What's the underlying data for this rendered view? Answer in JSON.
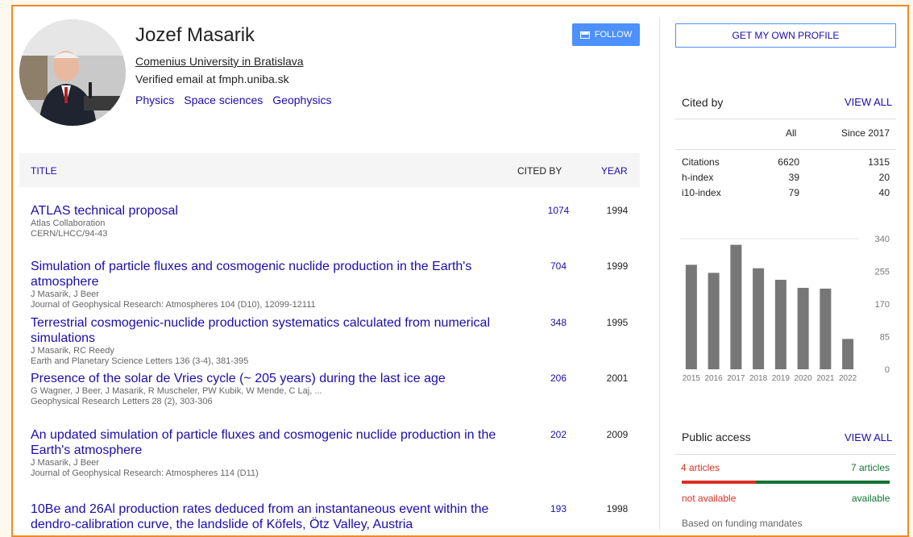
{
  "profile": {
    "name": "Jozef Masarik",
    "affiliation": "Comenius University in Bratislava",
    "email": "Verified email at fmph.uniba.sk",
    "interests": [
      "Physics",
      "Space sciences",
      "Geophysics"
    ],
    "follow_label": "FOLLOW",
    "get_profile_label": "GET MY OWN PROFILE"
  },
  "table": {
    "headers": {
      "title": "TITLE",
      "cited_by": "CITED BY",
      "year": "YEAR"
    },
    "rows": [
      {
        "title": "ATLAS technical proposal",
        "authors": "Atlas Collaboration",
        "venue": "CERN/LHCC/94-43",
        "cited_by": "1074",
        "year": "1994"
      },
      {
        "title": "Simulation of particle fluxes and cosmogenic nuclide production in the Earth's atmosphere",
        "authors": "J Masarik, J Beer",
        "venue": "Journal of Geophysical Research: Atmospheres 104 (D10), 12099-12111",
        "cited_by": "704",
        "year": "1999"
      },
      {
        "title": "Terrestrial cosmogenic-nuclide production systematics calculated from numerical simulations",
        "authors": "J Masarik, RC Reedy",
        "venue": "Earth and Planetary Science Letters 136 (3-4), 381-395",
        "cited_by": "348",
        "year": "1995"
      },
      {
        "title": "Presence of the solar de Vries cycle (~ 205 years) during the last ice age",
        "authors": "G Wagner, J Beer, J Masarik, R Muscheler, PW Kubik, W Mende, C Laj, ...",
        "venue": "Geophysical Research Letters 28 (2), 303-306",
        "cited_by": "206",
        "year": "2001"
      },
      {
        "title": "An updated simulation of particle fluxes and cosmogenic nuclide production in the Earth's atmosphere",
        "authors": "J Masarik, J Beer",
        "venue": "Journal of Geophysical Research: Atmospheres 114 (D11)",
        "cited_by": "202",
        "year": "2009"
      },
      {
        "title": "10Be and 26Al production rates deduced from an instantaneous event within the dendro-calibration curve, the landslide of Köfels, Ötz Valley, Austria",
        "authors": "",
        "venue": "",
        "cited_by": "193",
        "year": "1998"
      }
    ]
  },
  "cited_by": {
    "title": "Cited by",
    "view_all": "VIEW ALL",
    "col_all": "All",
    "col_since": "Since 2017",
    "rows": [
      {
        "label": "Citations",
        "all": "6620",
        "since": "1315"
      },
      {
        "label": "h-index",
        "all": "39",
        "since": "20"
      },
      {
        "label": "i10-index",
        "all": "79",
        "since": "40"
      }
    ]
  },
  "chart_data": {
    "type": "bar",
    "categories": [
      "2015",
      "2016",
      "2017",
      "2018",
      "2019",
      "2020",
      "2021",
      "2022"
    ],
    "values": [
      272,
      251,
      324,
      263,
      233,
      212,
      210,
      79
    ],
    "ylim": [
      0,
      340
    ],
    "yticks": [
      "340",
      "255",
      "170",
      "85",
      "0"
    ],
    "bar_color": "#777777"
  },
  "public_access": {
    "title": "Public access",
    "view_all": "VIEW ALL",
    "not_available_count": "4 articles",
    "available_count": "7 articles",
    "not_available_label": "not available",
    "available_label": "available",
    "note": "Based on funding mandates",
    "available_fraction": 0.64
  },
  "colors": {
    "accent_orange": "#f08a24",
    "link_blue": "#1a0dab",
    "button_blue": "#4d90fe",
    "red": "#d93025",
    "green": "#137333"
  }
}
